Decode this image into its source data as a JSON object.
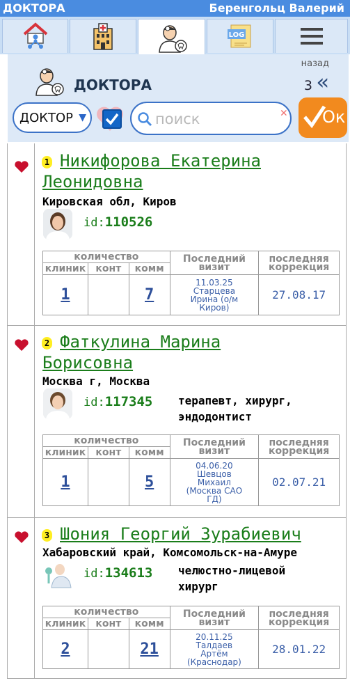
{
  "topbar": {
    "section": "ДОКТОРА",
    "user": "Беренгольц Валерий"
  },
  "tabs": [
    {
      "name": "home-network-icon"
    },
    {
      "name": "clinic-icon"
    },
    {
      "name": "doctor-icon"
    },
    {
      "name": "log-icon",
      "label": "LOG"
    },
    {
      "name": "menu-icon"
    }
  ],
  "header": {
    "title": "ДОКТОРА",
    "back_label": "назад",
    "back_count": "3",
    "select_value": "ДОКТОР",
    "search_placeholder": "поиск",
    "ok_label": "Ок"
  },
  "table_headers": {
    "qty": "количество",
    "clinics": "клиник",
    "cont": "конт",
    "comm": "комм",
    "last_visit": "Последний визит",
    "last_corr": "последняя коррекция"
  },
  "id_prefix": "id:",
  "doctors": [
    {
      "num": "1",
      "name_line1": "Никифорова Екатерина",
      "name_line2": "Леонидовна",
      "location": "Кировская обл, Киров",
      "id": "110526",
      "spec_line1": "",
      "spec_line2": "",
      "clinics": "1",
      "cont": "",
      "comm": "7",
      "visit_lines": [
        "11.03.25",
        "Старцева",
        "Ирина (о/м",
        "Киров)"
      ],
      "correction": "27.08.17"
    },
    {
      "num": "2",
      "name_line1": "Фаткулина Марина",
      "name_line2": "Борисовна",
      "location": "Москва г, Москва",
      "id": "117345",
      "spec_line1": "терапевт, хирург,",
      "spec_line2": "эндодонтист",
      "clinics": "1",
      "cont": "",
      "comm": "5",
      "visit_lines": [
        "04.06.20",
        "Шевцов",
        "Михаил",
        "(Москва САО",
        "ГД)"
      ],
      "correction": "02.07.21"
    },
    {
      "num": "3",
      "name_line1": "Шония Георгий Зурабиевич",
      "name_line2": "",
      "location": "Хабаровский край, Комсомольск-на-Амуре",
      "id": "134613",
      "spec_line1": "челюстно-лицевой",
      "spec_line2": "хирург",
      "clinics": "2",
      "cont": "",
      "comm": "21",
      "visit_lines": [
        "20.11.25",
        "Талдаев",
        "Артём",
        "(Краснодар)"
      ],
      "correction": "28.01.22"
    }
  ]
}
